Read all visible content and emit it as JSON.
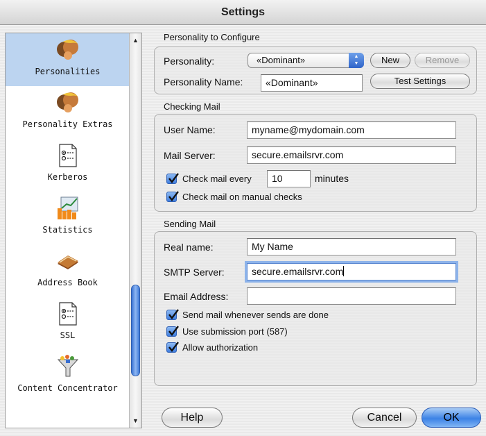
{
  "window": {
    "title": "Settings"
  },
  "sidebar": {
    "items": [
      {
        "label": "Personalities",
        "icon": "personalities-icon",
        "selected": true
      },
      {
        "label": "Personality Extras",
        "icon": "personality-extras-icon",
        "selected": false
      },
      {
        "label": "Kerberos",
        "icon": "kerberos-icon",
        "selected": false
      },
      {
        "label": "Statistics",
        "icon": "statistics-icon",
        "selected": false
      },
      {
        "label": "Address Book",
        "icon": "address-book-icon",
        "selected": false
      },
      {
        "label": "SSL",
        "icon": "ssl-icon",
        "selected": false
      },
      {
        "label": "Content Concentrator",
        "icon": "content-concentrator-icon",
        "selected": false
      }
    ]
  },
  "personality": {
    "section_title": "Personality to Configure",
    "personality_label": "Personality:",
    "personality_value": "«Dominant»",
    "new_button": "New",
    "remove_button": "Remove",
    "name_label": "Personality Name:",
    "name_value": "«Dominant»",
    "test_button": "Test Settings"
  },
  "checking": {
    "section_title": "Checking Mail",
    "user_label": "User Name:",
    "user_value": "myname@mydomain.com",
    "server_label": "Mail Server:",
    "server_value": "secure.emailsrvr.com",
    "check_every_label": "Check mail every",
    "check_every_value": "10",
    "minutes_label": "minutes",
    "manual_label": "Check mail on manual checks"
  },
  "sending": {
    "section_title": "Sending Mail",
    "real_name_label": "Real name:",
    "real_name_value": "My Name",
    "smtp_label": "SMTP Server:",
    "smtp_value": "secure.emailsrvr.com",
    "email_label": "Email Address:",
    "email_value": "",
    "send_whenever_label": "Send mail whenever sends are done",
    "submission_port_label": "Use submission port (587)",
    "allow_auth_label": "Allow authorization"
  },
  "footer": {
    "help": "Help",
    "cancel": "Cancel",
    "ok": "OK"
  },
  "colors": {
    "selection": "#bcd4f0",
    "accent": "#3c82e6"
  }
}
